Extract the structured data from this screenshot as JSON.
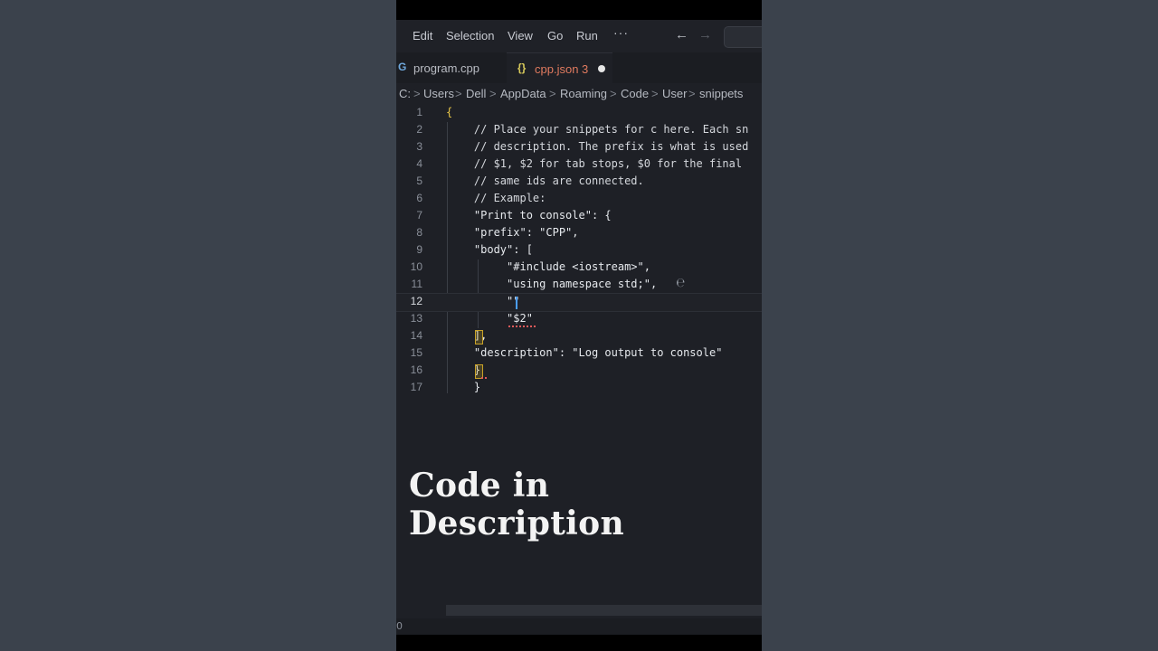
{
  "menubar": {
    "items": [
      "Edit",
      "Selection",
      "View",
      "Go",
      "Run"
    ],
    "more": "···",
    "back_icon": "arrow-left-icon",
    "forward_icon": "arrow-right-icon"
  },
  "tabs": [
    {
      "label": "program.cpp",
      "icon": "G",
      "icon_color": "#6fa8dc",
      "modified": false
    },
    {
      "label": "cpp.json 3",
      "icon": "{}",
      "icon_color": "#d7c95a",
      "modified": true,
      "active": true
    }
  ],
  "breadcrumbs": [
    "C:",
    "Users",
    "Dell",
    "AppData",
    "Roaming",
    "Code",
    "User",
    "snippets"
  ],
  "breadcrumb_separator": ">",
  "editor": {
    "active_line": 12,
    "lines": [
      {
        "n": "1",
        "text": "{"
      },
      {
        "n": "2",
        "text": "    // Place your snippets for c here. Each sn"
      },
      {
        "n": "3",
        "text": "    // description. The prefix is what is used"
      },
      {
        "n": "4",
        "text": "    // $1, $2 for tab stops, $0 for the final "
      },
      {
        "n": "5",
        "text": "    // same ids are connected."
      },
      {
        "n": "6",
        "text": "    // Example:"
      },
      {
        "n": "7",
        "text": "    \"Print to console\": {"
      },
      {
        "n": "8",
        "text": "    \"prefix\": \"CPP\","
      },
      {
        "n": "9",
        "text": "    \"body\": ["
      },
      {
        "n": "10",
        "text": "         \"#include <iostream>\","
      },
      {
        "n": "11",
        "text": "         \"using namespace std;\","
      },
      {
        "n": "12",
        "text": "         \"\""
      },
      {
        "n": "13",
        "text": "         \"$2\""
      },
      {
        "n": "14",
        "text": "    ],"
      },
      {
        "n": "15",
        "text": "    \"description\": \"Log output to console\""
      },
      {
        "n": "16",
        "text": "    }"
      },
      {
        "n": "17",
        "text": "    }"
      }
    ]
  },
  "caption": "Code in Description",
  "status_text": "0",
  "colors": {
    "editor_bg": "#1e2026",
    "active_tab_text": "#e07a5f",
    "accent_cursor": "#4a9eff",
    "error_squiggle": "#e05a5a"
  }
}
